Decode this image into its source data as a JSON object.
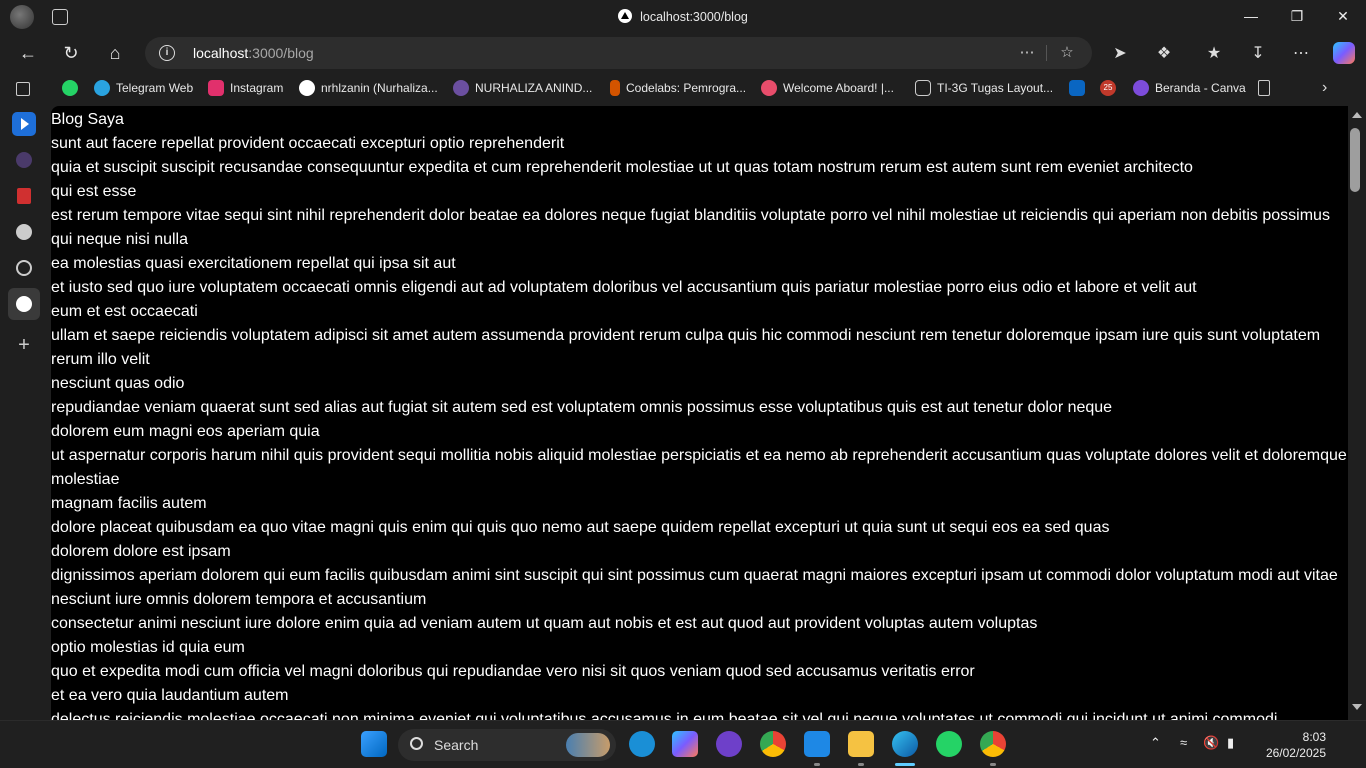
{
  "browser": {
    "tab_title": "localhost:3000/blog",
    "url_host": "localhost",
    "url_rest": ":3000/blog"
  },
  "bookmarks": [
    {
      "label": "Telegram Web",
      "color": "#2aa3e0"
    },
    {
      "label": "Instagram",
      "color": "#e1306c"
    },
    {
      "label": "nrhlzanin (Nurhaliza...",
      "color": "#ffffff"
    },
    {
      "label": "NURHALIZA ANIND...",
      "color": "#6b4fa0"
    },
    {
      "label": "Codelabs: Pemrogra...",
      "color": "#d35400"
    },
    {
      "label": "Welcome Aboard! |...",
      "color": "#e84d6b"
    },
    {
      "label": "TI-3G Tugas Layout...",
      "color": "#cccccc"
    },
    {
      "label": "Beranda - Canva",
      "color": "#7d4cdb"
    }
  ],
  "bookmark_badge": "25",
  "page": {
    "heading": "Blog Saya",
    "lines": [
      "sunt aut facere repellat provident occaecati excepturi optio reprehenderit",
      "quia et suscipit suscipit recusandae consequuntur expedita et cum reprehenderit molestiae ut ut quas totam nostrum rerum est autem sunt rem eveniet architecto",
      "qui est esse",
      "est rerum tempore vitae sequi sint nihil reprehenderit dolor beatae ea dolores neque fugiat blanditiis voluptate porro vel nihil molestiae ut reiciendis qui aperiam non debitis possimus qui neque nisi nulla",
      "ea molestias quasi exercitationem repellat qui ipsa sit aut",
      "et iusto sed quo iure voluptatem occaecati omnis eligendi aut ad voluptatem doloribus vel accusantium quis pariatur molestiae porro eius odio et labore et velit aut",
      "eum et est occaecati",
      "ullam et saepe reiciendis voluptatem adipisci sit amet autem assumenda provident rerum culpa quis hic commodi nesciunt rem tenetur doloremque ipsam iure quis sunt voluptatem rerum illo velit",
      "nesciunt quas odio",
      "repudiandae veniam quaerat sunt sed alias aut fugiat sit autem sed est voluptatem omnis possimus esse voluptatibus quis est aut tenetur dolor neque",
      "dolorem eum magni eos aperiam quia",
      "ut aspernatur corporis harum nihil quis provident sequi mollitia nobis aliquid molestiae perspiciatis et ea nemo ab reprehenderit accusantium quas voluptate dolores velit et doloremque molestiae",
      "magnam facilis autem",
      "dolore placeat quibusdam ea quo vitae magni quis enim qui quis quo nemo aut saepe quidem repellat excepturi ut quia sunt ut sequi eos ea sed quas",
      "dolorem dolore est ipsam",
      "dignissimos aperiam dolorem qui eum facilis quibusdam animi sint suscipit qui sint possimus cum quaerat magni maiores excepturi ipsam ut commodi dolor voluptatum modi aut vitae",
      "nesciunt iure omnis dolorem tempora et accusantium",
      "consectetur animi nesciunt iure dolore enim quia ad veniam autem ut quam aut nobis et est aut quod aut provident voluptas autem voluptas",
      "optio molestias id quia eum",
      "quo et expedita modi cum officia vel magni doloribus qui repudiandae vero nisi sit quos veniam quod sed accusamus veritatis error",
      "et ea vero quia laudantium autem",
      "delectus reiciendis molestiae occaecati non minima eveniet qui voluptatibus accusamus in eum beatae sit vel qui neque voluptates ut commodi qui incidunt ut animi commodi"
    ]
  },
  "taskbar": {
    "search_label": "Search",
    "time": "8:03",
    "date": "26/02/2025"
  }
}
